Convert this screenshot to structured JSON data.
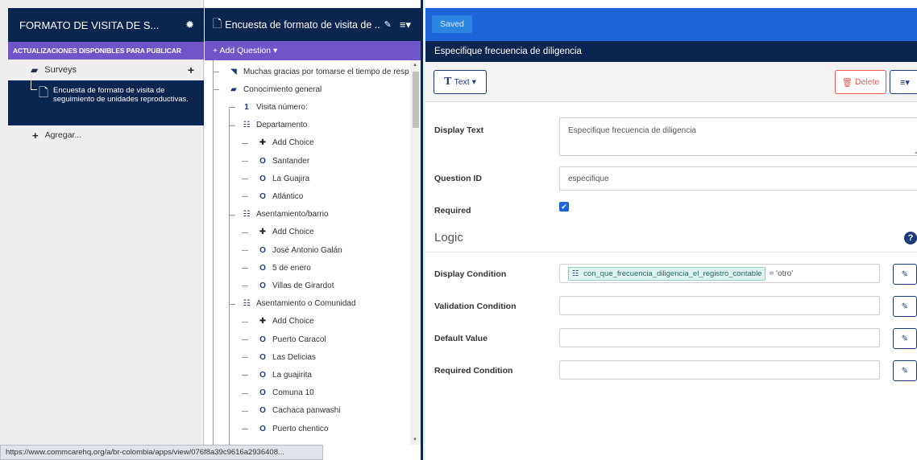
{
  "app": {
    "title": "FORMATO DE VISITA DE S...",
    "updates_banner": "ACTUALIZACIONES DISPONIBLES PARA PUBLICAR",
    "surveys_label": "Surveys",
    "form_name": "Encuesta de formato de visita de seguimiento de unidades reproductivas.",
    "add_label": "Agregar..."
  },
  "status_bar": {
    "url": "https://www.commcarehq.org/a/br-colombia/apps/view/076f8a39c9616a2936408..."
  },
  "tree_panel": {
    "form_title": "Encuesta de formato de visita de ...",
    "add_question_label": "+ Add Question ▾",
    "items": [
      {
        "label": "Muchas gracias por tomarse el tiempo de resp",
        "icon": "label-icon",
        "glyph": "◥",
        "level": 0
      },
      {
        "label": "Conocimiento general",
        "icon": "folder-icon",
        "glyph": "▰",
        "level": 0
      },
      {
        "label": "Visita número:",
        "icon": "number-icon",
        "glyph": "1",
        "level": 1
      },
      {
        "label": "Departamento",
        "icon": "single-select-icon",
        "glyph": "☷",
        "level": 1
      },
      {
        "label": "Add Choice",
        "icon": "add-icon",
        "glyph": "✚",
        "level": 2
      },
      {
        "label": "Santander",
        "icon": "choice-icon",
        "glyph": "O",
        "level": 2
      },
      {
        "label": "La Guajira",
        "icon": "choice-icon",
        "glyph": "O",
        "level": 2
      },
      {
        "label": "Atlántico",
        "icon": "choice-icon",
        "glyph": "O",
        "level": 2
      },
      {
        "label": "Asentamiento/barrio",
        "icon": "single-select-icon",
        "glyph": "☷",
        "level": 1
      },
      {
        "label": "Add Choice",
        "icon": "add-icon",
        "glyph": "✚",
        "level": 2
      },
      {
        "label": "José Antonio Galán",
        "icon": "choice-icon",
        "glyph": "O",
        "level": 2
      },
      {
        "label": "5 de enero",
        "icon": "choice-icon",
        "glyph": "O",
        "level": 2
      },
      {
        "label": "Villas de Girardot",
        "icon": "choice-icon",
        "glyph": "O",
        "level": 2
      },
      {
        "label": "Asentamiento o Comunidad",
        "icon": "single-select-icon",
        "glyph": "☷",
        "level": 1
      },
      {
        "label": "Add Choice",
        "icon": "add-icon",
        "glyph": "✚",
        "level": 2
      },
      {
        "label": "Puerto Caracol",
        "icon": "choice-icon",
        "glyph": "O",
        "level": 2
      },
      {
        "label": "Las Delicias",
        "icon": "choice-icon",
        "glyph": "O",
        "level": 2
      },
      {
        "label": "La guajirita",
        "icon": "choice-icon",
        "glyph": "O",
        "level": 2
      },
      {
        "label": "Comuna 10",
        "icon": "choice-icon",
        "glyph": "O",
        "level": 2
      },
      {
        "label": "Cachaca panwashi",
        "icon": "choice-icon",
        "glyph": "O",
        "level": 2
      },
      {
        "label": "Puerto chentico",
        "icon": "choice-icon",
        "glyph": "O",
        "level": 2
      }
    ]
  },
  "editor": {
    "saved_label": "Saved",
    "question_title": "Especifique frecuencia de diligencia",
    "type_label": "Text ▾",
    "delete_label": "Delete",
    "menu_label": "≡▾",
    "fields": {
      "display_text_label": "Display Text",
      "display_text_value": "Especifique frecuencia de diligencia",
      "question_id_label": "Question ID",
      "question_id_value": "especifique",
      "required_label": "Required",
      "required_checked": true
    },
    "logic": {
      "heading": "Logic",
      "display_condition_label": "Display Condition",
      "display_condition_token": "con_que_frecuencia_diligencia_el_registro_contable",
      "display_condition_rest": "= 'otro'",
      "validation_condition_label": "Validation Condition",
      "default_value_label": "Default Value",
      "required_condition_label": "Required Condition"
    }
  },
  "colors": {
    "navy": "#0a2550",
    "purple": "#6f55c8",
    "blue": "#1d64d8",
    "danger": "#e25b4a"
  }
}
